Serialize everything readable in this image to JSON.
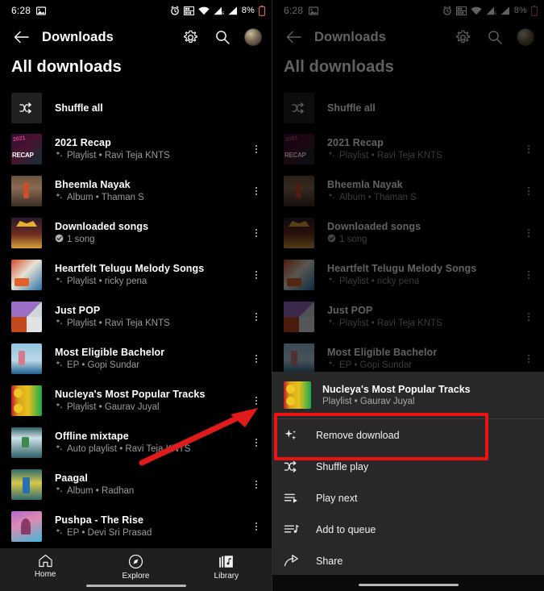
{
  "status_bar": {
    "time": "6:28",
    "battery": "8%",
    "icons": [
      "photo-icon",
      "alarm-icon",
      "vibrate-icon",
      "wifi-icon",
      "signal-r-icon",
      "signal-icon",
      "battery-icon"
    ]
  },
  "app_bar": {
    "back": "back-arrow",
    "title": "Downloads",
    "settings": "gear-icon",
    "search": "search-icon",
    "avatar": "account-avatar"
  },
  "section": {
    "title": "All downloads"
  },
  "shuffle_all": {
    "label": "Shuffle all",
    "icon": "shuffle-icon"
  },
  "downloads": [
    {
      "title": "2021 Recap",
      "meta": "Playlist • Ravi Teja KNTS",
      "badge": "sparkle",
      "art": "art-recap"
    },
    {
      "title": "Bheemla Nayak",
      "meta": "Album • Thaman S",
      "badge": "sparkle",
      "art": "art-bheemla"
    },
    {
      "title": "Downloaded songs",
      "meta": "1 song",
      "badge": "check",
      "art": "art-dsongs"
    },
    {
      "title": "Heartfelt Telugu Melody Songs",
      "meta": "Playlist • ricky pena",
      "badge": "sparkle",
      "art": "art-heart"
    },
    {
      "title": "Just POP",
      "meta": "Playlist • Ravi Teja KNTS",
      "badge": "sparkle",
      "art": "art-pop"
    },
    {
      "title": "Most Eligible Bachelor",
      "meta": "EP • Gopi Sundar",
      "badge": "sparkle",
      "art": "art-meb"
    },
    {
      "title": "Nucleya's Most Popular Tracks",
      "meta": "Playlist • Gaurav Juyal",
      "badge": "sparkle",
      "art": "art-nucleya"
    },
    {
      "title": "Offline mixtape",
      "meta": "Auto playlist • Ravi Teja KNTS",
      "badge": "sparkle",
      "art": "art-offline"
    },
    {
      "title": "Paagal",
      "meta": "Album • Radhan",
      "badge": "sparkle",
      "art": "art-paagal"
    },
    {
      "title": "Pushpa - The Rise",
      "meta": "EP • Devi Sri Prasad",
      "badge": "sparkle",
      "art": "art-pushpa"
    }
  ],
  "bottom_nav": [
    {
      "label": "Home",
      "icon": "home-icon",
      "active": false
    },
    {
      "label": "Explore",
      "icon": "compass-icon",
      "active": false
    },
    {
      "label": "Library",
      "icon": "library-icon",
      "active": true
    }
  ],
  "bottom_sheet": {
    "header": {
      "title": "Nucleya's Most Popular Tracks",
      "subtitle": "Playlist • Gaurav Juyal",
      "art": "art-nucleya"
    },
    "items": [
      {
        "label": "Remove download",
        "icon": "sparkle-icon",
        "highlighted": true
      },
      {
        "label": "Shuffle play",
        "icon": "shuffle-icon",
        "highlighted": false
      },
      {
        "label": "Play next",
        "icon": "play-next-icon",
        "highlighted": false
      },
      {
        "label": "Add to queue",
        "icon": "add-to-queue-icon",
        "highlighted": false
      },
      {
        "label": "Share",
        "icon": "share-icon",
        "highlighted": false
      }
    ]
  },
  "annotations": {
    "highlight_color": "#ee1111",
    "arrow_color": "#e01b1b"
  }
}
